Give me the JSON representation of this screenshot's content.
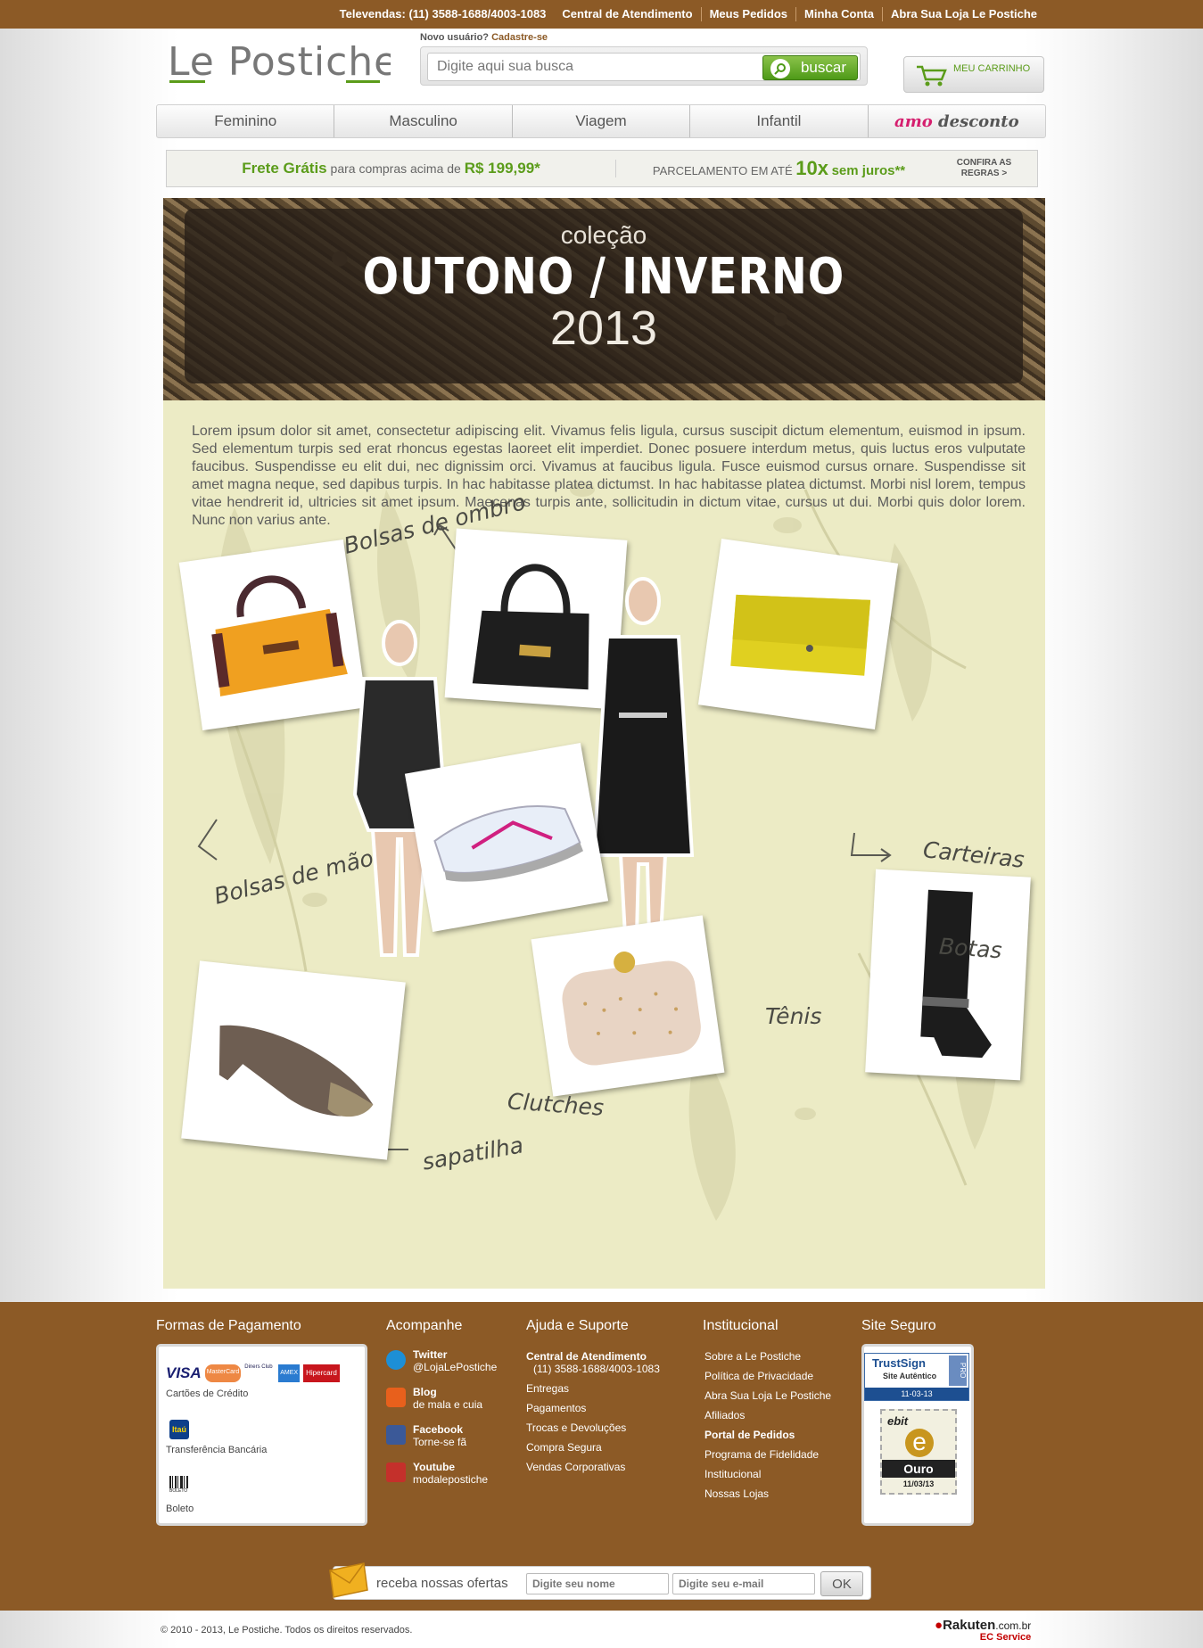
{
  "topbar": {
    "televendas": "Televendas: (11) 3588-1688/4003-1083",
    "links": [
      "Central de Atendimento",
      "Meus Pedidos",
      "Minha Conta",
      "Abra Sua Loja Le Postiche"
    ]
  },
  "header": {
    "logo_text": "Le Postiche",
    "novo_usuario": "Novo usuário?",
    "cadastre": "Cadastre-se",
    "search_placeholder": "Digite aqui sua busca",
    "search_button": "buscar",
    "cart_label": "MEU CARRINHO"
  },
  "nav": {
    "items": [
      "Feminino",
      "Masculino",
      "Viagem",
      "Infantil"
    ],
    "amo_prefix": "amo",
    "amo_suffix": "desconto"
  },
  "promo": {
    "frete_bold": "Frete Grátis",
    "frete_text": "para compras acima de",
    "frete_value": "R$ 199,99*",
    "parc_text": "PARCELAMENTO EM ATÉ",
    "parc_big": "10x",
    "parc_sj": "sem juros**",
    "confira": "CONFIRA AS REGRAS >"
  },
  "hero": {
    "line1": "coleção",
    "line2": "OUTONO / INVERNO",
    "line3": "2013"
  },
  "content": {
    "lorem": "Lorem ipsum dolor sit amet, consectetur adipiscing elit. Vivamus felis ligula, cursus suscipit dictum elementum, euismod in ipsum. Sed elementum turpis sed erat rhoncus egestas laoreet elit imperdiet. Donec posuere interdum metus, quis luctus eros vulputate faucibus. Suspendisse eu elit dui, nec dignissim orci. Vivamus at faucibus ligula. Fusce euismod cursus ornare. Suspendisse sit amet magna neque, sed dapibus turpis. In hac habitasse platea dictumst. In hac habitasse platea dictumst. Morbi nisl lorem, tempus vitae hendrerit id, ultricies sit amet ipsum. Maecenas turpis ante, sollicitudin in dictum vitae, cursus ut dui. Morbi quis dolor lorem. Nunc non varius ante.",
    "labels": {
      "bolsas_ombro": "Bolsas de ombro",
      "bolsas_mao": "Bolsas de mão",
      "carteiras": "Carteiras",
      "botas": "Botas",
      "tenis": "Tênis",
      "clutches": "Clutches",
      "sapatilha": "sapatilha"
    }
  },
  "footer": {
    "col_titles": [
      "Formas de Pagamento",
      "Acompanhe",
      "Ajuda e Suporte",
      "Institucional",
      "Site Seguro"
    ],
    "payment": {
      "cards": [
        "VISA",
        "MasterCard",
        "Diners Club",
        "AMEX",
        "Hipercard"
      ],
      "cartoes": "Cartões de Crédito",
      "itau": "Itaú",
      "transferencia": "Transferência Bancária",
      "boleto_icon": "BOLETO",
      "boleto": "Boleto"
    },
    "acompanhe": [
      {
        "title": "Twitter",
        "sub": "@LojaLePostiche",
        "icon": "twitter-icon",
        "color": "#1d8fd6"
      },
      {
        "title": "Blog",
        "sub": "de mala e cuia",
        "icon": "blogger-icon",
        "color": "#e8601c"
      },
      {
        "title": "Facebook",
        "sub": "Torne-se fã",
        "icon": "facebook-icon",
        "color": "#3b5998"
      },
      {
        "title": "Youtube",
        "sub": "modalepostiche",
        "icon": "youtube-icon",
        "color": "#c4302b"
      }
    ],
    "ajuda": {
      "central_title": "Central de Atendimento",
      "central_phone": "(11) 3588-1688/4003-1083",
      "items": [
        "Entregas",
        "Pagamentos",
        "Trocas e Devoluções",
        "Compra Segura",
        "Vendas Corporativas"
      ]
    },
    "institucional": {
      "items": [
        "Sobre a Le Postiche",
        "Política de Privacidade",
        "Abra Sua Loja Le Postiche",
        "Afiliados"
      ],
      "portal": "Portal de Pedidos",
      "items2": [
        "Programa de Fidelidade",
        "Institucional",
        "Nossas Lojas"
      ]
    },
    "seguro": {
      "trustsign": "TrustSign",
      "trust_sub": "Site Autêntico",
      "trust_pro": "PRO",
      "trust_date": "11-03-13",
      "ebit": "ebit",
      "ebit_e": "e",
      "ebit_ouro": "Ouro",
      "ebit_date": "11/03/13"
    },
    "newsletter": {
      "label": "receba nossas ofertas",
      "name_placeholder": "Digite seu nome",
      "email_placeholder": "Digite seu e-mail",
      "ok": "OK"
    },
    "copyright": "© 2010 - 2013, Le Postiche. Todos os direitos reservados.",
    "rakuten": "Rakuten",
    "rakuten_domain": ".com.br",
    "ec_service": "EC Service"
  },
  "colors": {
    "brand_brown": "#8c5a26",
    "accent_green": "#5b9c1a",
    "amo_pink": "#d51e6e",
    "content_bg": "#ecebc5"
  }
}
